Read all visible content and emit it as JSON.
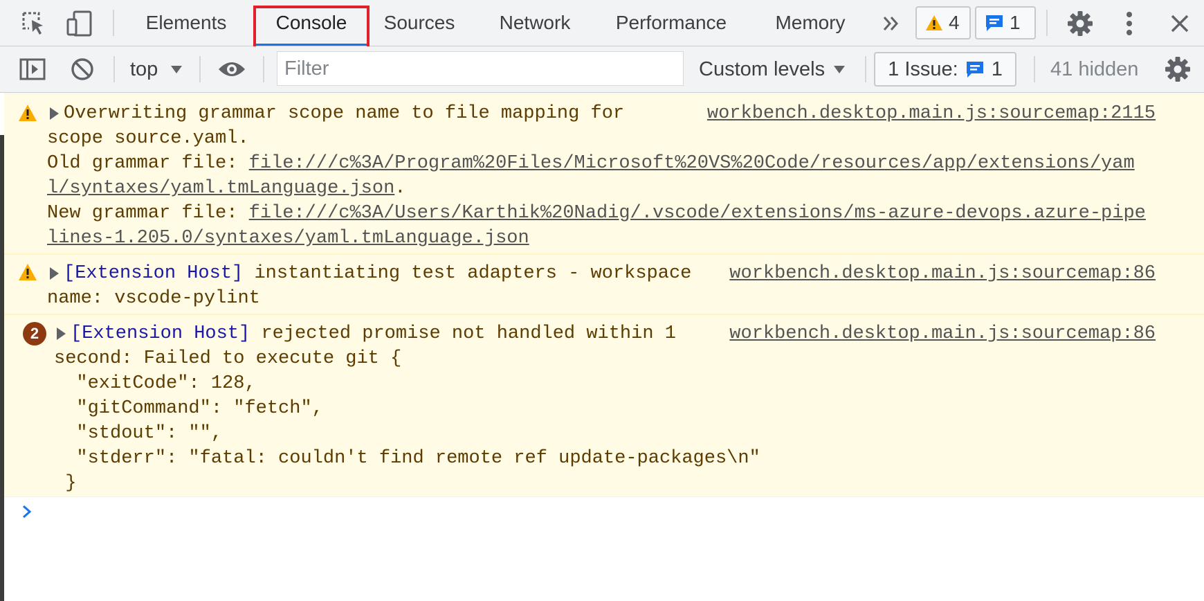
{
  "tabs": [
    {
      "label": "Elements"
    },
    {
      "label": "Console"
    },
    {
      "label": "Sources"
    },
    {
      "label": "Network"
    },
    {
      "label": "Performance"
    },
    {
      "label": "Memory"
    }
  ],
  "status": {
    "warnings_count": "4",
    "messages_count": "1"
  },
  "toolbar": {
    "context": "top",
    "filter_placeholder": "Filter",
    "levels": "Custom levels",
    "issues_label": "1 Issue:",
    "issues_count": "1",
    "hidden": "41 hidden"
  },
  "messages": [
    {
      "level": "warning",
      "source": "workbench.desktop.main.js:sourcemap:2115",
      "line1": "Overwriting grammar scope name to file mapping for",
      "line2": "scope source.yaml.",
      "old_label": "Old grammar file: ",
      "old_link_1": "file:///c%3A/Program%20Files/Microsoft%20VS%20Code/resources/app/extensions/yam",
      "old_link_2": "l/syntaxes/yaml.tmLanguage.json",
      "old_end": ".",
      "new_label": "New grammar file: ",
      "new_link_1": "file:///c%3A/Users/Karthik%20Nadig/.vscode/extensions/ms-azure-devops.azure-pipe",
      "new_link_2": "lines-1.205.0/syntaxes/yaml.tmLanguage.json"
    },
    {
      "level": "warning",
      "source": "workbench.desktop.main.js:sourcemap:86",
      "host": "[Extension Host]",
      "line1": " instantiating test adapters - workspace",
      "line2": "name: vscode-pylint"
    },
    {
      "level": "warning",
      "repeat_count": "2",
      "source": "workbench.desktop.main.js:sourcemap:86",
      "host": "[Extension Host]",
      "line1": " rejected promise not handled within 1",
      "body": [
        "second: Failed to execute git {",
        "  \"exitCode\": 128,",
        "  \"gitCommand\": \"fetch\",",
        "  \"stdout\": \"\",",
        "  \"stderr\": \"fatal: couldn't find remote ref update-packages\\n\"",
        " }"
      ]
    }
  ],
  "colors": {
    "accent": "#1a73e8",
    "warning_bg": "#fffbe5",
    "warning_icon": "#f9ab00",
    "highlight": "#e0202a"
  },
  "icons": [
    "inspect-element-icon",
    "device-toolbar-icon",
    "more-tabs-icon",
    "warning-icon",
    "message-icon",
    "settings-icon",
    "kebab-menu-icon",
    "close-icon",
    "sidebar-toggle-icon",
    "clear-console-icon",
    "dropdown-arrow-icon",
    "eye-icon",
    "prompt-chevron-icon"
  ]
}
